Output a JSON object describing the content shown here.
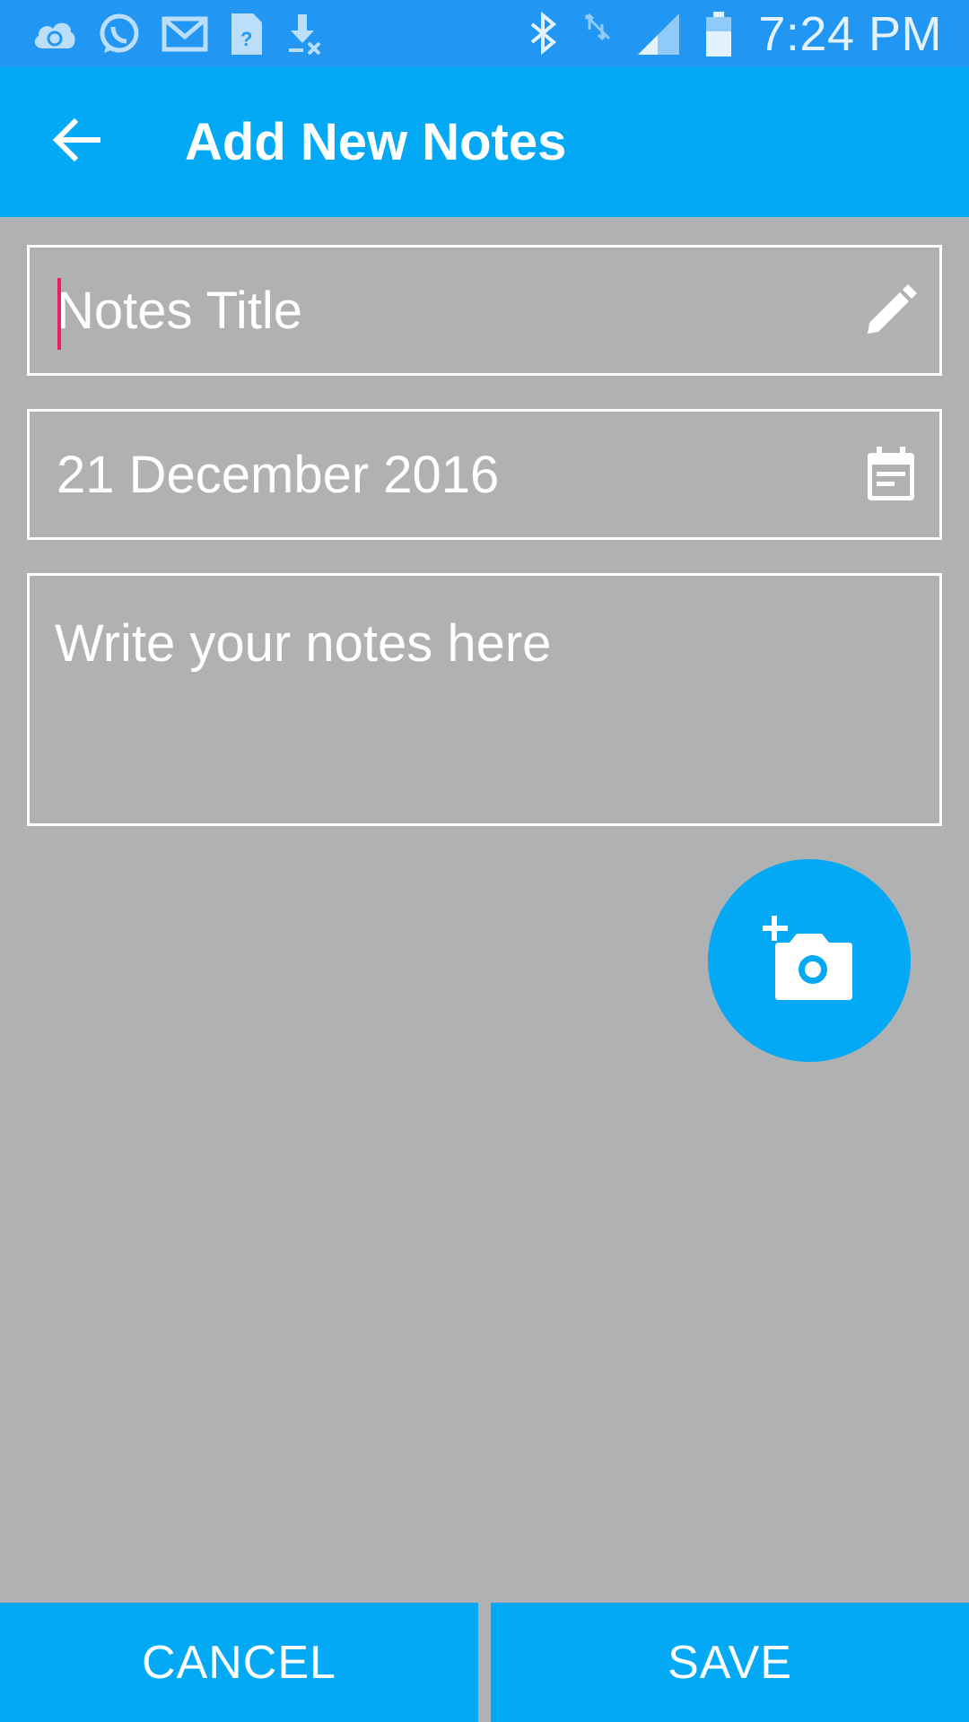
{
  "status_bar": {
    "time": "7:24 PM",
    "left_icons": [
      "cloud-sync-icon",
      "whatsapp-icon",
      "gmail-icon",
      "sim-unknown-icon",
      "download-icon"
    ],
    "right_icons": [
      "bluetooth-icon",
      "no-data-icon",
      "cell-signal-icon",
      "battery-icon"
    ]
  },
  "app_bar": {
    "title": "Add New Notes",
    "back_icon": "arrow-back-icon"
  },
  "form": {
    "title_placeholder": "Notes Title",
    "date_value": "21 December 2016",
    "notes_placeholder": "Write your notes here",
    "title_icon": "pencil-icon",
    "date_icon": "calendar-icon"
  },
  "fab": {
    "icon": "add-photo-icon"
  },
  "buttons": {
    "cancel_label": "CANCEL",
    "save_label": "SAVE"
  },
  "colors": {
    "status_bar": "#2196f3",
    "app_bar": "#03a9f4",
    "background": "#b0b1b3",
    "caret": "#e91e63"
  }
}
